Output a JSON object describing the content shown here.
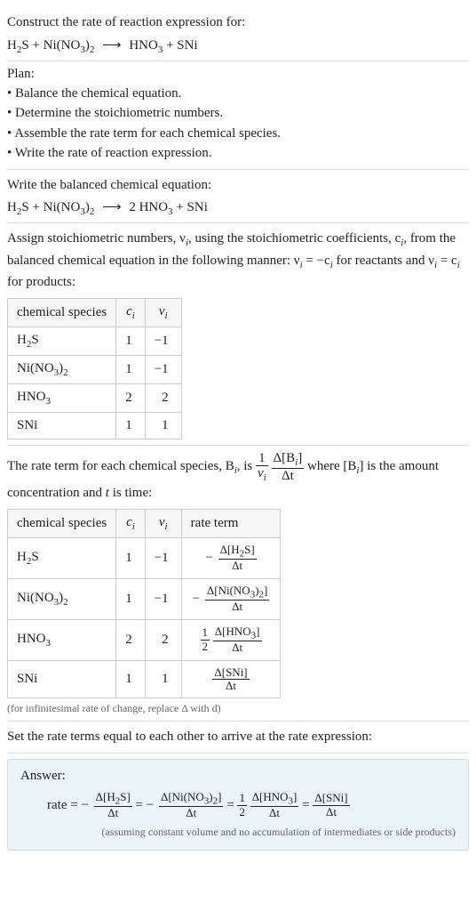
{
  "prompt": {
    "heading": "Construct the rate of reaction expression for:",
    "eq_left": "H₂S + Ni(NO₃)₂",
    "arrow": "⟶",
    "eq_right": "HNO₃ + SNi"
  },
  "plan": {
    "heading": "Plan:",
    "items": [
      "Balance the chemical equation.",
      "Determine the stoichiometric numbers.",
      "Assemble the rate term for each chemical species.",
      "Write the rate of reaction expression."
    ]
  },
  "balanced": {
    "intro": "Write the balanced chemical equation:",
    "eq_left": "H₂S + Ni(NO₃)₂",
    "arrow": "⟶",
    "eq_right": "2 HNO₃ + SNi"
  },
  "stoich": {
    "intro_before_ci": "Assign stoichiometric numbers, νᵢ, using the stoichiometric coefficients, cᵢ, from the balanced chemical equation in the following manner: νᵢ = −cᵢ for reactants and νᵢ = cᵢ for products:",
    "headers": [
      "chemical species",
      "cᵢ",
      "νᵢ"
    ],
    "rows": [
      {
        "species": "H₂S",
        "c": "1",
        "nu": "−1"
      },
      {
        "species": "Ni(NO₃)₂",
        "c": "1",
        "nu": "−1"
      },
      {
        "species": "HNO₃",
        "c": "2",
        "nu": "2"
      },
      {
        "species": "SNi",
        "c": "1",
        "nu": "1"
      }
    ]
  },
  "rateterms": {
    "intro_parts": {
      "p1": "The rate term for each chemical species, Bᵢ, is ",
      "one_over_nu_num": "1",
      "one_over_nu_den": "νᵢ",
      "delta_num": "Δ[Bᵢ]",
      "delta_den": "Δt",
      "p2": " where [Bᵢ] is the amount concentration and ",
      "t_var": "t",
      "p3": " is time:"
    },
    "headers": [
      "chemical species",
      "cᵢ",
      "νᵢ",
      "rate term"
    ],
    "rows": [
      {
        "species": "H₂S",
        "c": "1",
        "nu": "−1",
        "neg": "−",
        "pre_num": "",
        "pre_den": "",
        "frac_num": "Δ[H₂S]",
        "frac_den": "Δt"
      },
      {
        "species": "Ni(NO₃)₂",
        "c": "1",
        "nu": "−1",
        "neg": "−",
        "pre_num": "",
        "pre_den": "",
        "frac_num": "Δ[Ni(NO₃)₂]",
        "frac_den": "Δt"
      },
      {
        "species": "HNO₃",
        "c": "2",
        "nu": "2",
        "neg": "",
        "pre_num": "1",
        "pre_den": "2",
        "frac_num": "Δ[HNO₃]",
        "frac_den": "Δt"
      },
      {
        "species": "SNi",
        "c": "1",
        "nu": "1",
        "neg": "",
        "pre_num": "",
        "pre_den": "",
        "frac_num": "Δ[SNi]",
        "frac_den": "Δt"
      }
    ],
    "note": "(for infinitesimal rate of change, replace Δ with d)"
  },
  "finalstep": {
    "text": "Set the rate terms equal to each other to arrive at the rate expression:"
  },
  "answer": {
    "heading": "Answer:",
    "rate_prefix": "rate = ",
    "terms": [
      {
        "neg": "−",
        "coef_num": "",
        "coef_den": "",
        "num": "Δ[H₂S]",
        "den": "Δt"
      },
      {
        "neg": "−",
        "coef_num": "",
        "coef_den": "",
        "num": "Δ[Ni(NO₃)₂]",
        "den": "Δt"
      },
      {
        "neg": "",
        "coef_num": "1",
        "coef_den": "2",
        "num": "Δ[HNO₃]",
        "den": "Δt"
      },
      {
        "neg": "",
        "coef_num": "",
        "coef_den": "",
        "num": "Δ[SNi]",
        "den": "Δt"
      }
    ],
    "eq_sign": " = ",
    "note": "(assuming constant volume and no accumulation of intermediates or side products)"
  }
}
